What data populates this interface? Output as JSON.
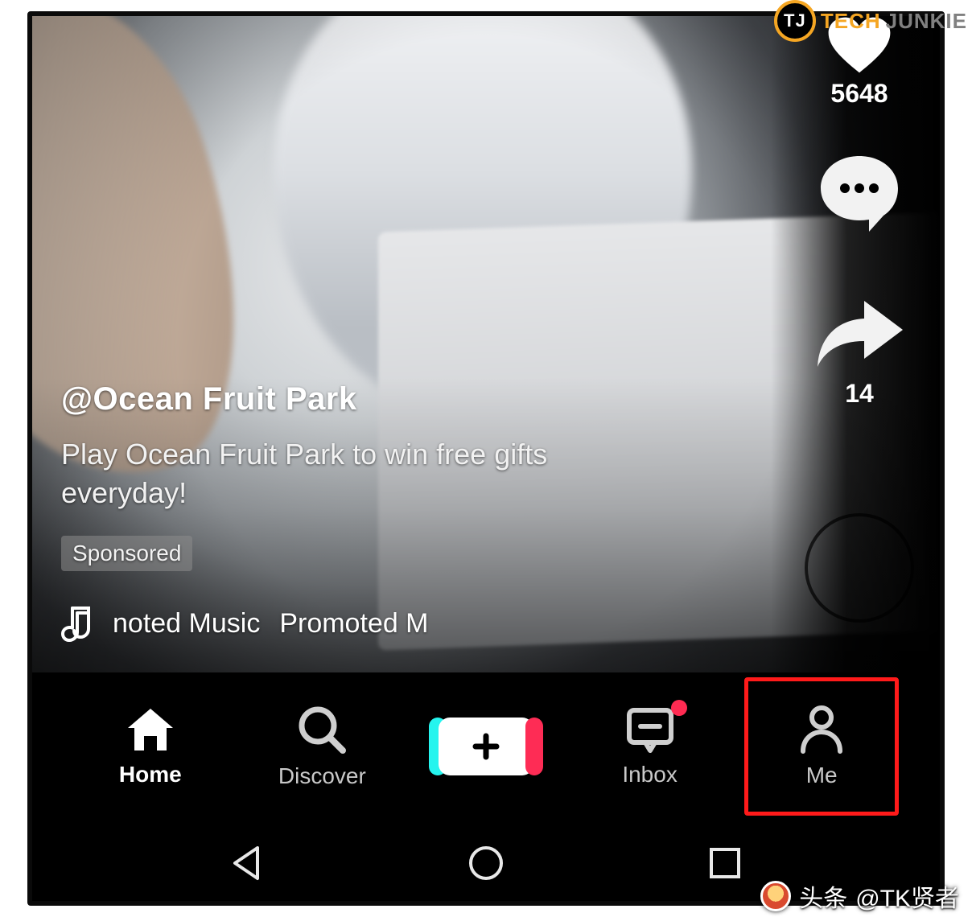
{
  "badge": {
    "logo_text": "TJ",
    "word1": "TECH",
    "word2": "JUNKIE"
  },
  "video": {
    "likes_count": "5648",
    "shares_count": "14",
    "username": "@Ocean Fruit Park",
    "caption": "Play Ocean Fruit Park to win free gifts everyday!",
    "sponsored_label": "Sponsored",
    "music_text_1": "noted Music",
    "music_text_2": "Promoted M"
  },
  "tabs": {
    "home": "Home",
    "discover": "Discover",
    "inbox": "Inbox",
    "me": "Me"
  },
  "attribution": {
    "prefix": "头条",
    "handle": "@TK贤者"
  },
  "icons": {
    "heart": "heart-icon",
    "comment": "comment-icon",
    "share": "share-icon",
    "disc": "music-disc-icon",
    "music": "music-note-icon",
    "home": "home-icon",
    "search": "search-icon",
    "create": "plus-icon",
    "inbox": "inbox-icon",
    "me": "person-icon",
    "android_back": "back-triangle-icon",
    "android_home": "circle-icon",
    "android_recent": "square-icon"
  },
  "colors": {
    "accent_cyan": "#25f4ee",
    "accent_pink": "#fe2c55",
    "highlight_red": "#ff1a1a",
    "notif_red": "#ff2b52",
    "tj_orange": "#f5a623"
  }
}
